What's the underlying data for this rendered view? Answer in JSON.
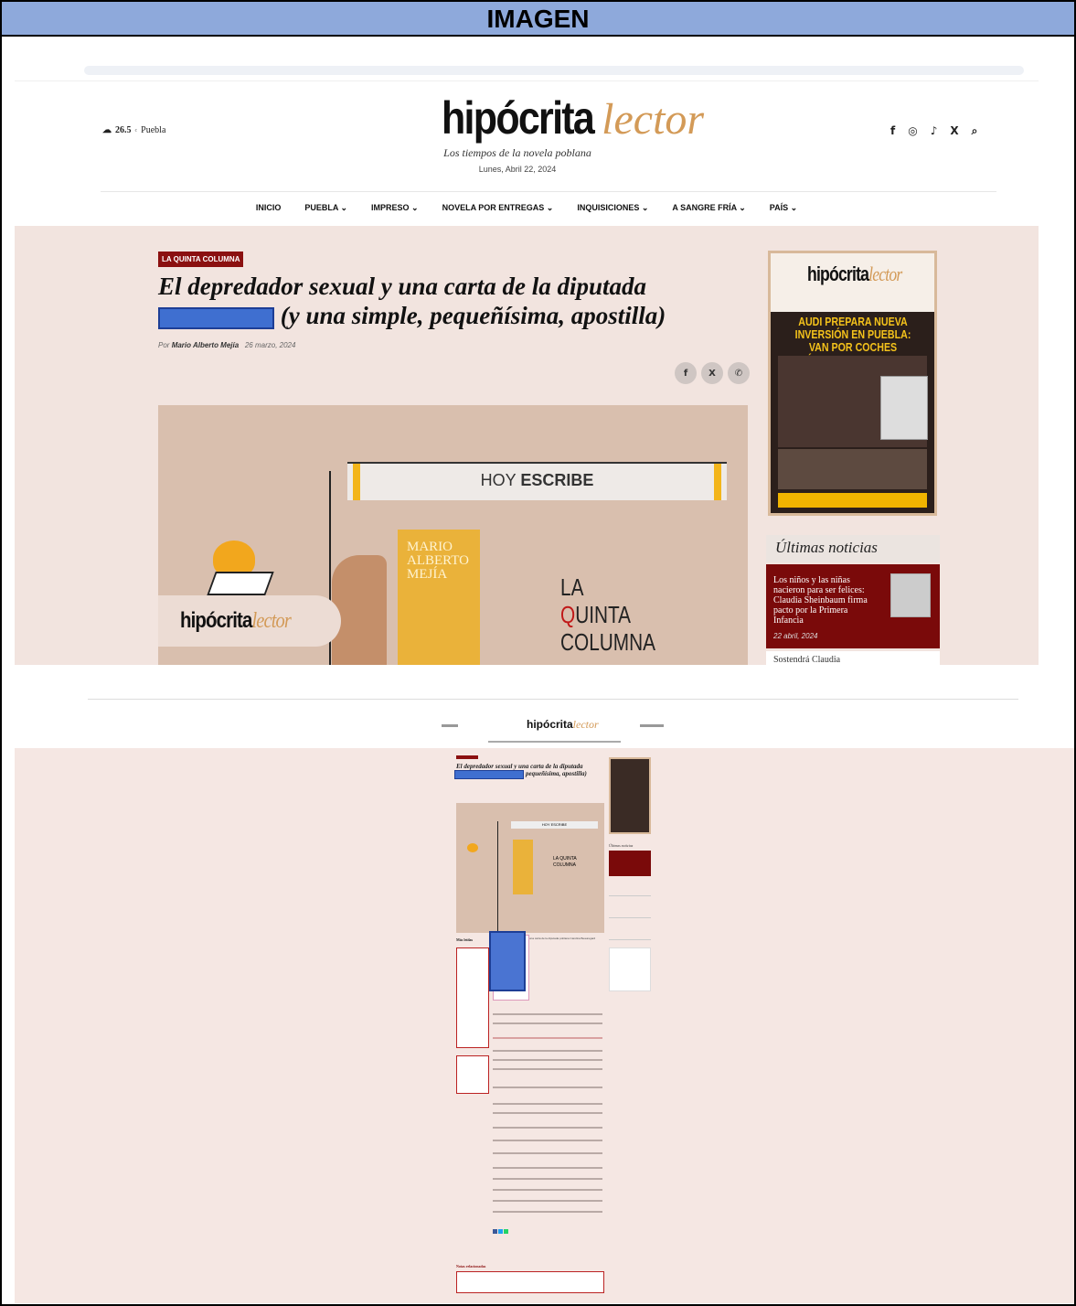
{
  "header_label": "IMAGEN",
  "site": {
    "weather_temp": "26.5",
    "weather_unit": "c",
    "weather_city": "Puebla",
    "logo_primary": "hipócrita",
    "logo_secondary": "lector",
    "tagline": "Los tiempos de la novela poblana",
    "date": "Lunes, Abril 22, 2024",
    "social_icons": [
      "facebook-icon",
      "instagram-icon",
      "tiktok-icon",
      "x-icon",
      "search-icon"
    ],
    "social_glyphs": [
      "f",
      "◎",
      "♪",
      "X",
      "⌕"
    ]
  },
  "nav": {
    "items": [
      {
        "label": "INICIO"
      },
      {
        "label": "PUEBLA ⌄"
      },
      {
        "label": "IMPRESO ⌄"
      },
      {
        "label": "NOVELA POR ENTREGAS ⌄"
      },
      {
        "label": "INQUISICIONES ⌄"
      },
      {
        "label": "A SANGRE FRÍA ⌄"
      },
      {
        "label": "PAÍS ⌄"
      }
    ]
  },
  "article": {
    "category": "LA QUINTA COLUMNA",
    "title_part1": "El depredador sexual y una carta de la diputada",
    "title_part2": "(y una simple, pequeñísima, apostilla)",
    "byline_prefix": "Por",
    "author": "Mario Alberto Mejía",
    "date": "26 marzo, 2024",
    "share_glyphs": [
      "f",
      "X",
      "✆"
    ]
  },
  "featured_image": {
    "hoy": "HOY",
    "escribe": "ESCRIBE",
    "columnist": "MARIO ALBERTO MEJÍA",
    "section_line1": "LA",
    "section_q": "Q",
    "section_line2": "UINTA",
    "section_line3": "COLUMNA",
    "logo_primary": "hipócrita",
    "logo_secondary": "lector"
  },
  "sidebar": {
    "cover_logo_primary": "hipócrita",
    "cover_logo_secondary": "lector",
    "cover_headline": "AUDI PREPARA NUEVA INVERSIÓN EN PUEBLA: VAN POR COCHES ELÉCTRICOS EN CHIAPA",
    "ultimas_title": "Últimas noticias",
    "news": [
      {
        "title": "Los niños y las niñas nacieron para ser felices: Claudia Sheinbaum firma pacto por la Primera Infancia",
        "date": "22 abril, 2024"
      },
      {
        "title": "Sostendrá Claudia"
      }
    ]
  },
  "thumbnail": {
    "logo_primary": "hipócrita",
    "logo_secondary": "lector",
    "title": "El depredador sexual y una carta de la diputada",
    "title_end": "pequeñísima, apostilla)",
    "feat_hoy": "HOY ESCRIBE",
    "feat_section": "LA QUINTA COLUMNA",
    "ultimas": "Últimas noticias",
    "lead_line": "una carta de la diputada poblana Carolina Beauregard",
    "related": "Notas relacionadas"
  }
}
